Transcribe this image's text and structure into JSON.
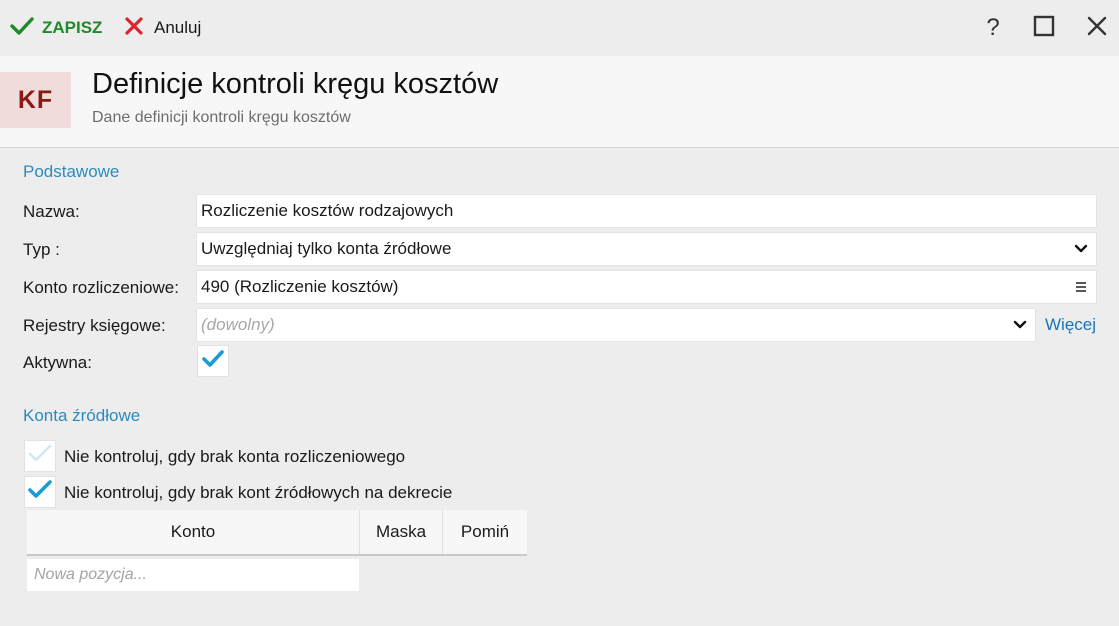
{
  "toolbar": {
    "save_label": "ZAPISZ",
    "cancel_label": "Anuluj",
    "help_label": "?"
  },
  "header": {
    "badge": "KF",
    "title": "Definicje kontroli kręgu kosztów",
    "subtitle": "Dane definicji kontroli kręgu kosztów"
  },
  "basic": {
    "section_title": "Podstawowe",
    "name_label": "Nazwa:",
    "name_value": "Rozliczenie kosztów rodzajowych",
    "type_label": "Typ :",
    "type_value": "Uwzględniaj tylko konta źródłowe",
    "account_label": "Konto rozliczeniowe:",
    "account_value": "490 (Rozliczenie kosztów)",
    "registers_label": "Rejestry księgowe:",
    "registers_placeholder": "(dowolny)",
    "more_link": "Więcej",
    "active_label": "Aktywna:",
    "active_checked": true
  },
  "sources": {
    "section_title": "Konta źródłowe",
    "check1_label": "Nie kontroluj, gdy brak konta rozliczeniowego",
    "check1_checked": false,
    "check2_label": "Nie kontroluj, gdy brak kont źródłowych na dekrecie",
    "check2_checked": true,
    "grid": {
      "columns": [
        "Konto",
        "Maska",
        "Pomiń"
      ],
      "new_row_placeholder": "Nowa pozycja..."
    }
  },
  "colors": {
    "accent_blue": "#2b8bbf",
    "check_blue": "#1a9bd7",
    "save_green": "#1f8a2a",
    "cancel_red": "#d8262c",
    "badge_red": "#8b1b12"
  }
}
